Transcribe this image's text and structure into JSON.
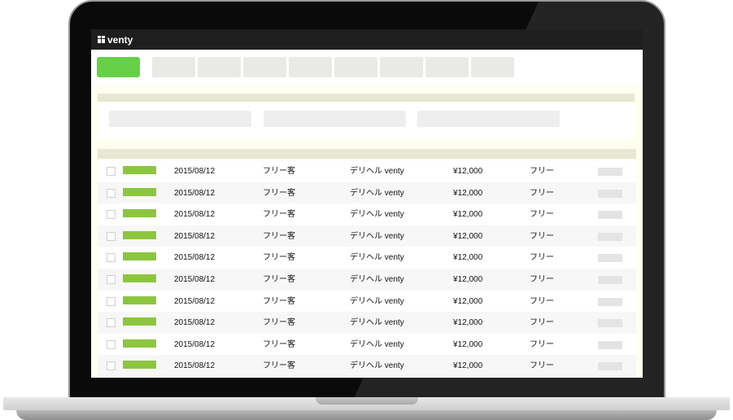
{
  "app": {
    "name": "venty"
  },
  "toolbar": {
    "tab_count": 8
  },
  "filters": {
    "count": 3
  },
  "table": {
    "rows": [
      {
        "date": "2015/08/12",
        "customer": "フリー客",
        "shop": "デリヘル venty",
        "price": "¥12,000",
        "type": "フリー"
      },
      {
        "date": "2015/08/12",
        "customer": "フリー客",
        "shop": "デリヘル venty",
        "price": "¥12,000",
        "type": "フリー"
      },
      {
        "date": "2015/08/12",
        "customer": "フリー客",
        "shop": "デリヘル venty",
        "price": "¥12,000",
        "type": "フリー"
      },
      {
        "date": "2015/08/12",
        "customer": "フリー客",
        "shop": "デリヘル venty",
        "price": "¥12,000",
        "type": "フリー"
      },
      {
        "date": "2015/08/12",
        "customer": "フリー客",
        "shop": "デリヘル venty",
        "price": "¥12,000",
        "type": "フリー"
      },
      {
        "date": "2015/08/12",
        "customer": "フリー客",
        "shop": "デリヘル venty",
        "price": "¥12,000",
        "type": "フリー"
      },
      {
        "date": "2015/08/12",
        "customer": "フリー客",
        "shop": "デリヘル venty",
        "price": "¥12,000",
        "type": "フリー"
      },
      {
        "date": "2015/08/12",
        "customer": "フリー客",
        "shop": "デリヘル venty",
        "price": "¥12,000",
        "type": "フリー"
      },
      {
        "date": "2015/08/12",
        "customer": "フリー客",
        "shop": "デリヘル venty",
        "price": "¥12,000",
        "type": "フリー"
      },
      {
        "date": "2015/08/12",
        "customer": "フリー客",
        "shop": "デリヘル venty",
        "price": "¥12,000",
        "type": "フリー"
      }
    ]
  },
  "colors": {
    "primary": "#66d148",
    "tag": "#8cc63f",
    "header": "#1f1f1f",
    "panel_head": "#e7e7d3",
    "background": "#fffff0"
  },
  "icons": {
    "logo": "grid-logo-icon"
  }
}
